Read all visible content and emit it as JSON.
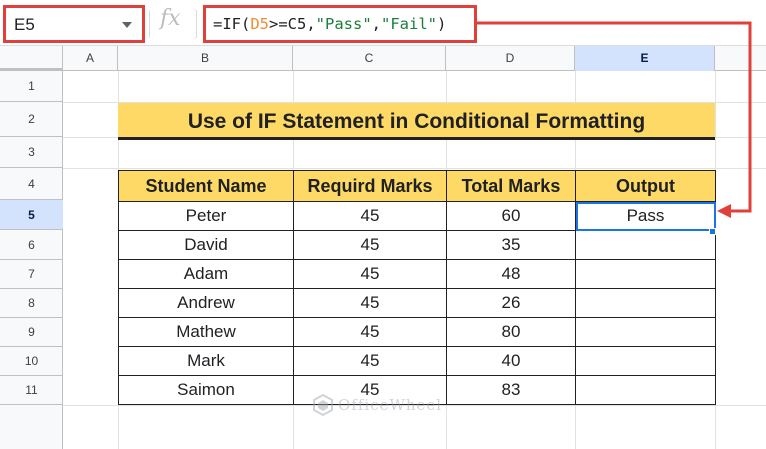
{
  "formula_bar": {
    "name_box": "E5",
    "fx_label": "fx",
    "formula_parts": {
      "prefix": "=IF(",
      "d5_ref": "D5",
      "op_ref": ">=C5,",
      "str1": "\"Pass\"",
      "comma": ",",
      "str2": "\"Fail\"",
      "suffix": ")"
    }
  },
  "columns": [
    "A",
    "B",
    "C",
    "D",
    "E"
  ],
  "rows": [
    "1",
    "2",
    "3",
    "4",
    "5",
    "6",
    "7",
    "8",
    "9",
    "10",
    "11"
  ],
  "selected_cell": "E5",
  "title": "Use of IF Statement in Conditional Formatting",
  "table": {
    "headers": [
      "Student Name",
      "Requird Marks",
      "Total Marks",
      "Output"
    ],
    "rows": [
      [
        "Peter",
        "45",
        "60",
        "Pass"
      ],
      [
        "David",
        "45",
        "35",
        ""
      ],
      [
        "Adam",
        "45",
        "48",
        ""
      ],
      [
        "Andrew",
        "45",
        "26",
        ""
      ],
      [
        "Mathew",
        "45",
        "80",
        ""
      ],
      [
        "Mark",
        "45",
        "40",
        ""
      ],
      [
        "Saimon",
        "45",
        "83",
        ""
      ]
    ]
  },
  "watermark": "OfficeWheel",
  "colors": {
    "highlight_red": "#e0403a",
    "header_yellow": "#fed966",
    "selection_blue": "#1a73e8"
  }
}
